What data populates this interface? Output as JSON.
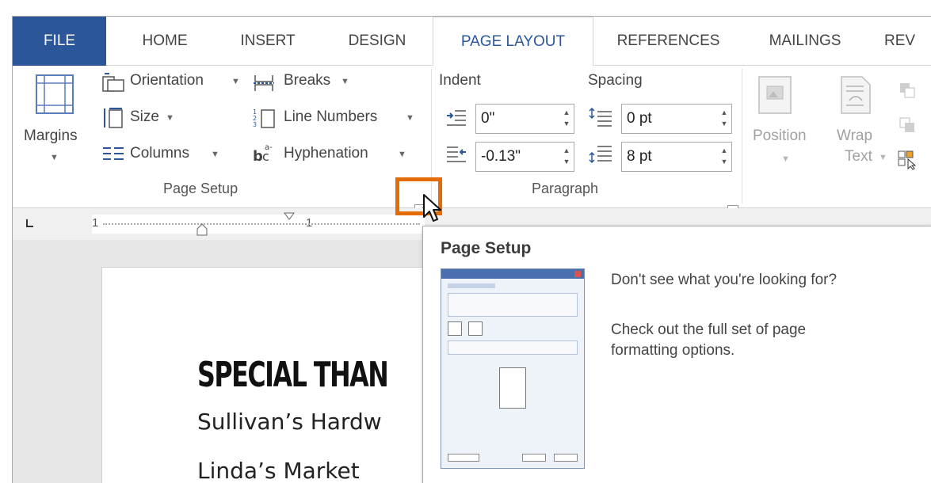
{
  "tabs": [
    {
      "label": "FILE"
    },
    {
      "label": "HOME"
    },
    {
      "label": "INSERT"
    },
    {
      "label": "DESIGN"
    },
    {
      "label": "PAGE LAYOUT"
    },
    {
      "label": "REFERENCES"
    },
    {
      "label": "MAILINGS"
    },
    {
      "label": "REV"
    }
  ],
  "page_setup": {
    "margins_label": "Margins",
    "orientation_label": "Orientation",
    "size_label": "Size",
    "columns_label": "Columns",
    "breaks_label": "Breaks",
    "line_numbers_label": "Line Numbers",
    "hyphenation_label": "Hyphenation",
    "group_label": "Page Setup"
  },
  "paragraph": {
    "indent_label": "Indent",
    "spacing_label": "Spacing",
    "indent_left": "0\"",
    "indent_right": "-0.13\"",
    "spacing_before": "0 pt",
    "spacing_after": "8 pt",
    "group_label": "Paragraph"
  },
  "arrange": {
    "position_label": "Position",
    "wrap_label_1": "Wrap",
    "wrap_label_2": "Text"
  },
  "ruler": {
    "ruler_mark_1": "1",
    "ruler_mark_2": "1"
  },
  "document": {
    "heading": "SPECIAL THAN",
    "line1": "Sullivan’s Hardw",
    "line2": "Linda’s Market"
  },
  "tooltip": {
    "title": "Page Setup",
    "text1": "Don't see what you're looking for?",
    "text2": "Check out the full set of page formatting options."
  },
  "colors": {
    "file_tab": "#2b579a",
    "highlight": "#e36c09"
  }
}
